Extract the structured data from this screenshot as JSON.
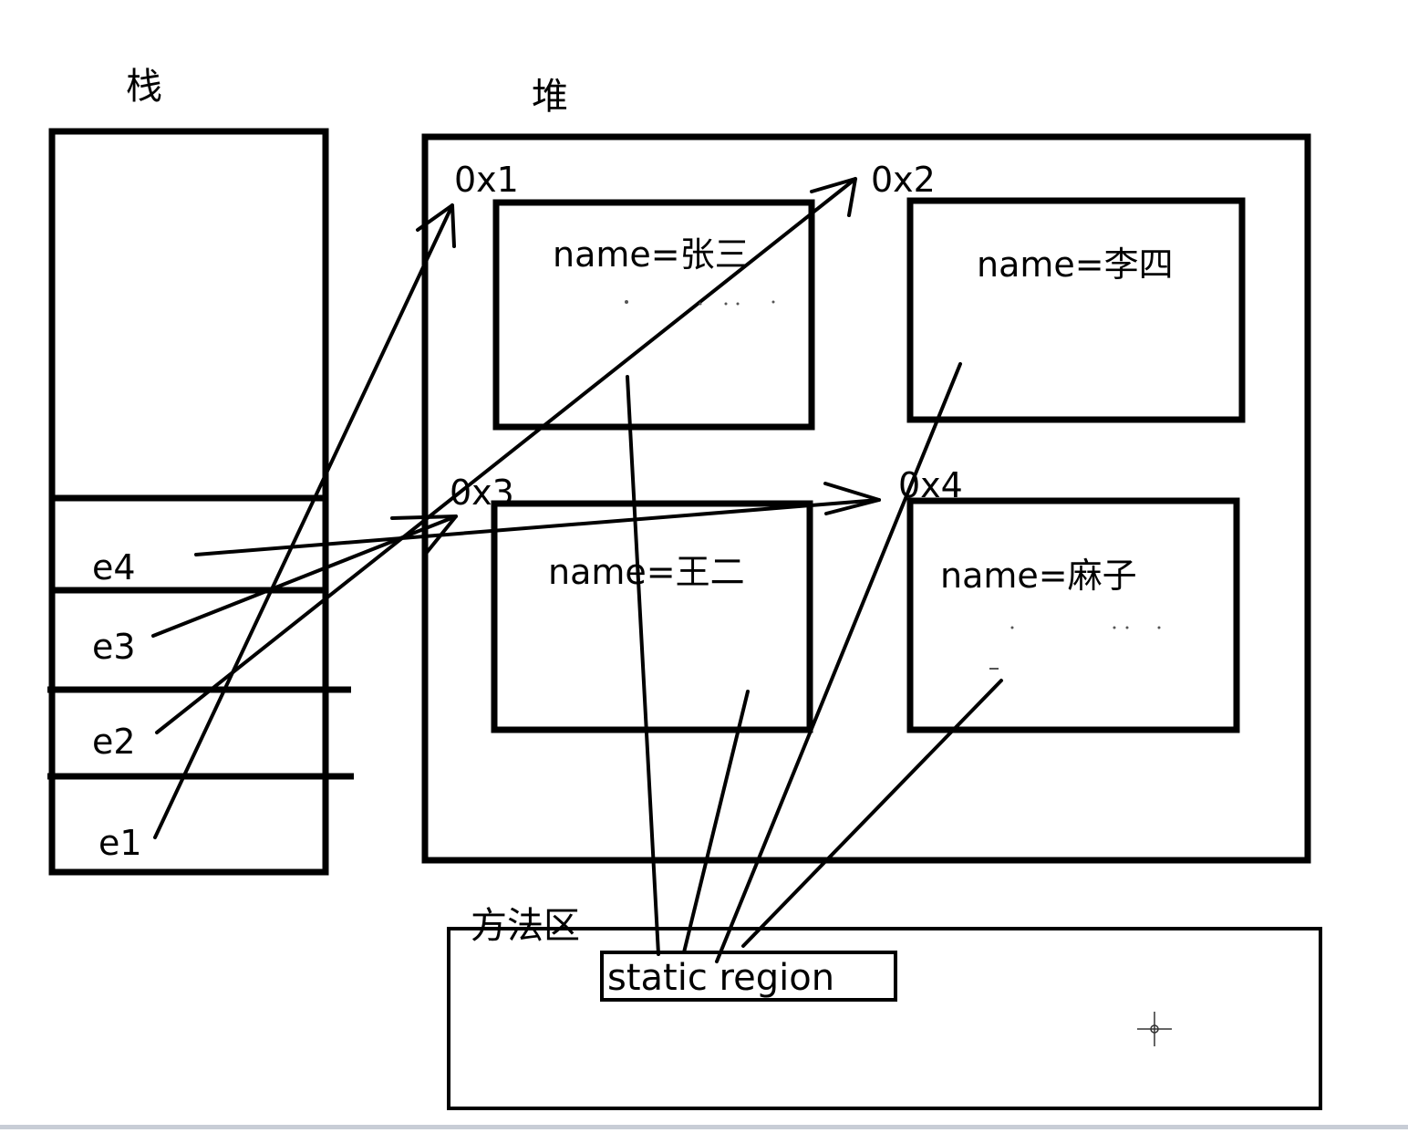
{
  "labels": {
    "stack": "栈",
    "heap": "堆",
    "method_area": "方法区",
    "static_region": "static region"
  },
  "stack_vars": [
    "e4",
    "e3",
    "e2",
    "e1"
  ],
  "objects": [
    {
      "address": "0x1",
      "field": "name=张三"
    },
    {
      "address": "0x2",
      "field": "name=李四"
    },
    {
      "address": "0x3",
      "field": "name=王二"
    },
    {
      "address": "0x4",
      "field": "name=麻子"
    }
  ]
}
